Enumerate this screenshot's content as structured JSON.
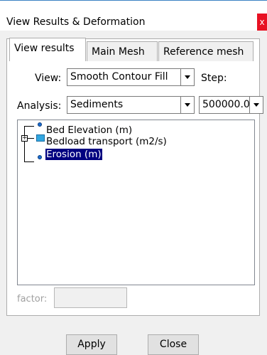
{
  "window": {
    "title": "View Results & Deformation",
    "close_glyph": "x"
  },
  "tabs": [
    {
      "label": "View results",
      "active": true
    },
    {
      "label": "Main Mesh",
      "active": false
    },
    {
      "label": "Reference mesh",
      "active": false
    }
  ],
  "form": {
    "view_label": "View:",
    "view_value": "Smooth Contour Fill",
    "step_label": "Step:",
    "analysis_label": "Analysis:",
    "analysis_value": "Sediments",
    "step_value": "500000.0"
  },
  "tree": {
    "items": [
      {
        "label": "Bed Elevation (m)",
        "icon": "dot-icon",
        "expandable": false,
        "selected": false
      },
      {
        "label": "Bedload transport (m2/s)",
        "icon": "square-icon",
        "expandable": true,
        "selected": false
      },
      {
        "label": "Erosion (m)",
        "icon": "dot-icon",
        "expandable": false,
        "selected": true
      }
    ],
    "expander_glyph": "+"
  },
  "factor": {
    "label": "factor:",
    "value": ""
  },
  "buttons": {
    "apply": "Apply",
    "close": "Close"
  },
  "colors": {
    "selection": "#000080",
    "close_button": "#e81123",
    "tree_icon_blue": "#31a6e0"
  }
}
